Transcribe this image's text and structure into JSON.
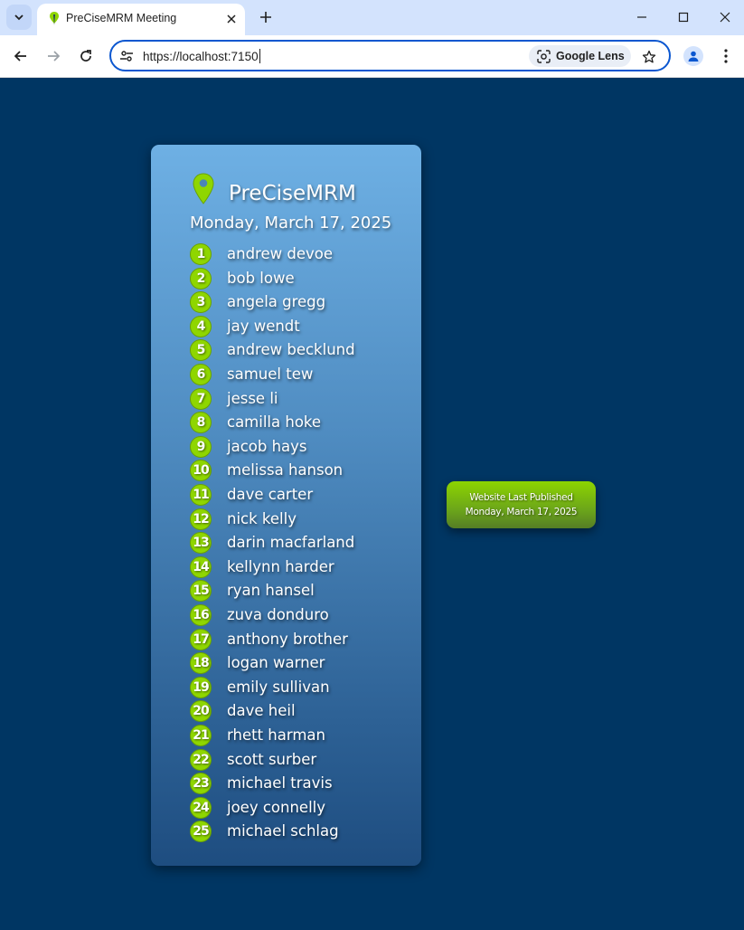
{
  "browser": {
    "tab_title": "PreCiseMRM Meeting",
    "url": "https://localhost:7150",
    "lens_label": "Google Lens",
    "accent_color": "#0b57d0"
  },
  "page": {
    "brand": "PreCiseMRM",
    "date": "Monday, March 17, 2025",
    "background_color": "#003663",
    "badge_color": "#8fd600",
    "attendees": [
      {
        "number": "1",
        "name": "andrew devoe"
      },
      {
        "number": "2",
        "name": "bob lowe"
      },
      {
        "number": "3",
        "name": "angela gregg"
      },
      {
        "number": "4",
        "name": "jay wendt"
      },
      {
        "number": "5",
        "name": "andrew becklund"
      },
      {
        "number": "6",
        "name": "samuel tew"
      },
      {
        "number": "7",
        "name": "jesse li"
      },
      {
        "number": "8",
        "name": "camilla hoke"
      },
      {
        "number": "9",
        "name": "jacob hays"
      },
      {
        "number": "10",
        "name": "melissa hanson"
      },
      {
        "number": "11",
        "name": "dave carter"
      },
      {
        "number": "12",
        "name": "nick kelly"
      },
      {
        "number": "13",
        "name": "darin macfarland"
      },
      {
        "number": "14",
        "name": "kellynn harder"
      },
      {
        "number": "15",
        "name": "ryan hansel"
      },
      {
        "number": "16",
        "name": "zuva donduro"
      },
      {
        "number": "17",
        "name": "anthony brother"
      },
      {
        "number": "18",
        "name": "logan warner"
      },
      {
        "number": "19",
        "name": "emily sullivan"
      },
      {
        "number": "20",
        "name": "dave heil"
      },
      {
        "number": "21",
        "name": "rhett harman"
      },
      {
        "number": "22",
        "name": "scott surber"
      },
      {
        "number": "23",
        "name": "michael travis"
      },
      {
        "number": "24",
        "name": "joey connelly"
      },
      {
        "number": "25",
        "name": "michael schlag"
      }
    ],
    "published": {
      "line1": "Website Last Published",
      "line2": "Monday, March 17, 2025"
    }
  }
}
